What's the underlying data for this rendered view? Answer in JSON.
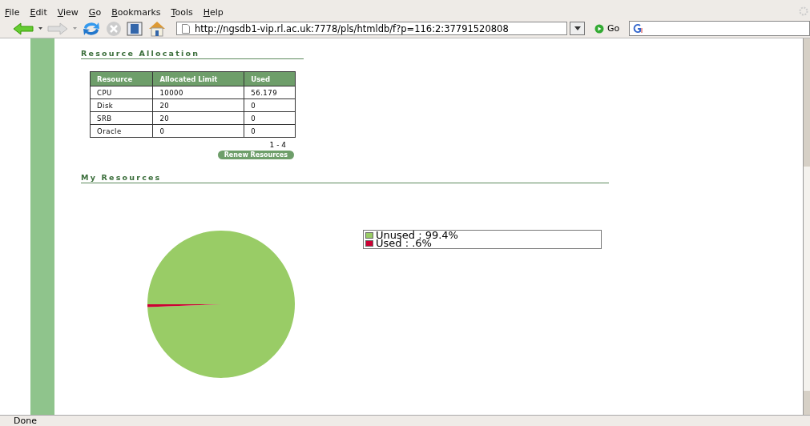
{
  "menu": [
    "File",
    "Edit",
    "View",
    "Go",
    "Bookmarks",
    "Tools",
    "Help"
  ],
  "toolbar": {
    "url": "http://ngsdb1-vip.rl.ac.uk:7778/pls/htmldb/f?p=116:2:37791520808",
    "go": "Go"
  },
  "resource_allocation": {
    "title": "Resource Allocation",
    "columns": [
      "Resource",
      "Allocated Limit",
      "Used"
    ],
    "rows": [
      [
        "CPU",
        "10000",
        "56.179"
      ],
      [
        "Disk",
        "20",
        "0"
      ],
      [
        "SRB",
        "20",
        "0"
      ],
      [
        "Oracle",
        "0",
        "0"
      ]
    ],
    "pagination": "1 - 4",
    "button": "Renew Resources"
  },
  "my_resources": {
    "title": "My Resources",
    "legend": [
      {
        "color": "#99cc66"
      },
      {
        "color": "#cc0033"
      }
    ],
    "chart_data": {
      "type": "pie",
      "legend": "right",
      "categories": [
        "Unused : 99.4%",
        "Used : .6%"
      ],
      "values": [
        99.4,
        0.6
      ]
    }
  },
  "status_bar": "Done"
}
